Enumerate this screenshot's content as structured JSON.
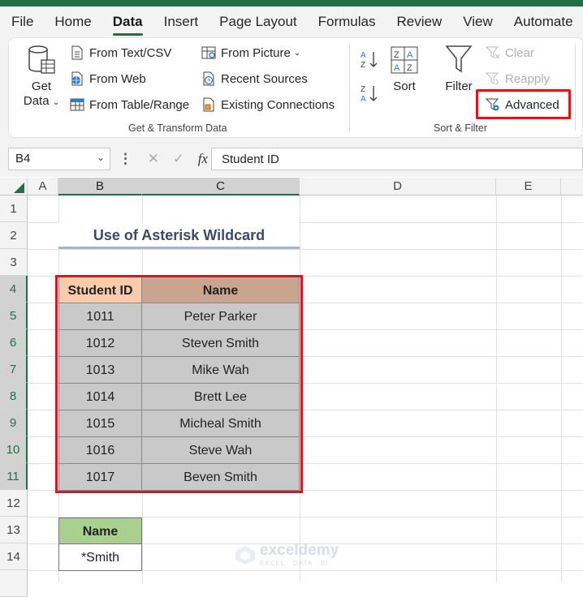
{
  "tabs": [
    "File",
    "Home",
    "Data",
    "Insert",
    "Page Layout",
    "Formulas",
    "Review",
    "View",
    "Automate"
  ],
  "active_tab": "Data",
  "ribbon": {
    "get_data": "Get",
    "get_data2": "Data",
    "from_text_csv": "From Text/CSV",
    "from_web": "From Web",
    "from_table_range": "From Table/Range",
    "from_picture": "From Picture",
    "recent_sources": "Recent Sources",
    "existing_connections": "Existing Connections",
    "group_get_transform": "Get & Transform Data",
    "sort": "Sort",
    "filter": "Filter",
    "clear": "Clear",
    "reapply": "Reapply",
    "advanced": "Advanced",
    "group_sort_filter": "Sort & Filter"
  },
  "formula_bar": {
    "name_box": "B4",
    "fx": "fx",
    "value": "Student ID"
  },
  "columns": [
    "A",
    "B",
    "C",
    "D",
    "E"
  ],
  "rows": [
    "1",
    "2",
    "3",
    "4",
    "5",
    "6",
    "7",
    "8",
    "9",
    "10",
    "11",
    "12",
    "13",
    "14"
  ],
  "sheet": {
    "title": "Use of Asterisk Wildcard",
    "headers": [
      "Student ID",
      "Name"
    ],
    "data": [
      [
        "1011",
        "Peter Parker"
      ],
      [
        "1012",
        "Steven Smith"
      ],
      [
        "1013",
        "Mike Wah"
      ],
      [
        "1014",
        "Brett Lee"
      ],
      [
        "1015",
        "Micheal Smith"
      ],
      [
        "1016",
        "Steve Wah"
      ],
      [
        "1017",
        "Beven Smith"
      ]
    ],
    "criteria_header": "Name",
    "criteria_value": "*Smith"
  },
  "watermark": {
    "name": "exceldemy",
    "tagline": "EXCEL · DATA · BI"
  },
  "colors": {
    "excel_green": "#1e7145",
    "highlight_red": "#e0141e",
    "header_peach": "#f8cbad",
    "header_tan": "#c9a48f",
    "data_gray": "#c9c9c9",
    "criteria_green": "#a9d08e"
  }
}
